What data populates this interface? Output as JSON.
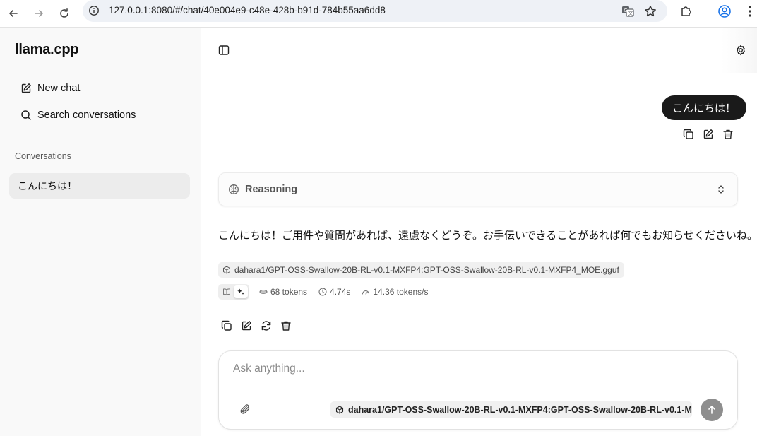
{
  "browser": {
    "url": "127.0.0.1:8080/#/chat/40e004e9-c48e-428b-b91d-784b55aa6dd8"
  },
  "sidebar": {
    "brand": "llama.cpp",
    "new_chat": "New chat",
    "search": "Search conversations",
    "conversations_header": "Conversations",
    "conversations": [
      {
        "title": "こんにちは！"
      }
    ]
  },
  "chat": {
    "user_message": "こんにちは！",
    "reasoning_label": "Reasoning",
    "assistant_message": "こんにちは！ご用件や質問があれば、遠慮なくどうぞ。お手伝いできることがあれば何でもお知らせくださいね。",
    "model": "dahara1/GPT-OSS-Swallow-20B-RL-v0.1-MXFP4:GPT-OSS-Swallow-20B-RL-v0.1-MXFP4_MOE.gguf",
    "stats": {
      "tokens": "68 tokens",
      "time": "4.74s",
      "speed": "14.36 tokens/s"
    }
  },
  "composer": {
    "placeholder": "Ask anything...",
    "selected_model": "dahara1/GPT-OSS-Swallow-20B-RL-v0.1-MXFP4:GPT-OSS-Swallow-20B-RL-v0.1-MXFP4..."
  }
}
